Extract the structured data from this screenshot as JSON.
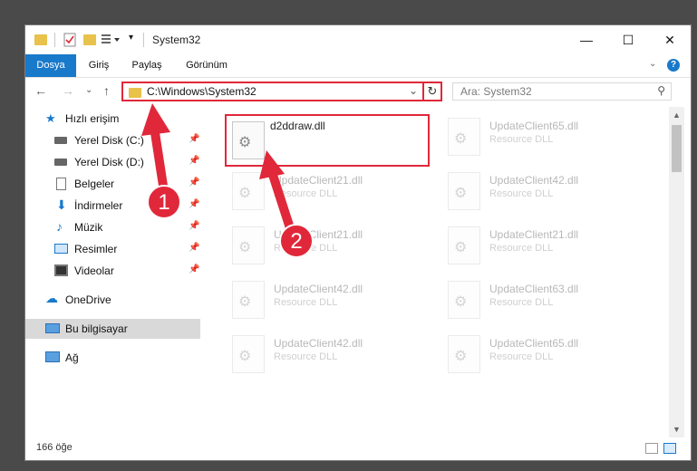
{
  "window": {
    "title": "System32"
  },
  "ribbon": {
    "tabs": [
      {
        "label": "Dosya",
        "active": true
      },
      {
        "label": "Giriş",
        "active": false
      },
      {
        "label": "Paylaş",
        "active": false
      },
      {
        "label": "Görünüm",
        "active": false
      }
    ],
    "help": "?"
  },
  "address": {
    "path": "C:\\Windows\\System32",
    "search_placeholder": "Ara: System32"
  },
  "nav": {
    "items": [
      {
        "label": "Hızlı erişim",
        "icon": "star-icon",
        "pinned": false
      },
      {
        "label": "Yerel Disk (C:)",
        "icon": "drive-icon",
        "pinned": true
      },
      {
        "label": "Yerel Disk (D:)",
        "icon": "drive-icon",
        "pinned": true
      },
      {
        "label": "Belgeler",
        "icon": "documents-icon",
        "pinned": true
      },
      {
        "label": "İndirmeler",
        "icon": "download-icon",
        "pinned": true
      },
      {
        "label": "Müzik",
        "icon": "music-icon",
        "pinned": true
      },
      {
        "label": "Resimler",
        "icon": "pictures-icon",
        "pinned": true
      },
      {
        "label": "Videolar",
        "icon": "videos-icon",
        "pinned": true
      },
      {
        "label": "OneDrive",
        "icon": "cloud-icon",
        "pinned": false
      },
      {
        "label": "Bu bilgisayar",
        "icon": "computer-icon",
        "pinned": false,
        "selected": true
      },
      {
        "label": "Ağ",
        "icon": "network-icon",
        "pinned": false
      }
    ]
  },
  "files": [
    {
      "name": "d2ddraw.dll",
      "type": "",
      "selected": true
    },
    {
      "name": "UpdateClient65.dll",
      "type": "Resource DLL"
    },
    {
      "name": "UpdateClient21.dll",
      "type": "Resource DLL"
    },
    {
      "name": "UpdateClient42.dll",
      "type": "Resource DLL"
    },
    {
      "name": "UpdateClient21.dll",
      "type": "Resource DLL"
    },
    {
      "name": "UpdateClient21.dll",
      "type": "Resource DLL"
    },
    {
      "name": "UpdateClient42.dll",
      "type": "Resource DLL"
    },
    {
      "name": "UpdateClient63.dll",
      "type": "Resource DLL"
    },
    {
      "name": "UpdateClient42.dll",
      "type": "Resource DLL"
    },
    {
      "name": "UpdateClient65.dll",
      "type": "Resource DLL"
    }
  ],
  "status": {
    "count": "166 öğe"
  },
  "annotations": {
    "step1": "1",
    "step2": "2"
  },
  "colors": {
    "accent": "#1979ca",
    "highlight": "#e0283a"
  }
}
